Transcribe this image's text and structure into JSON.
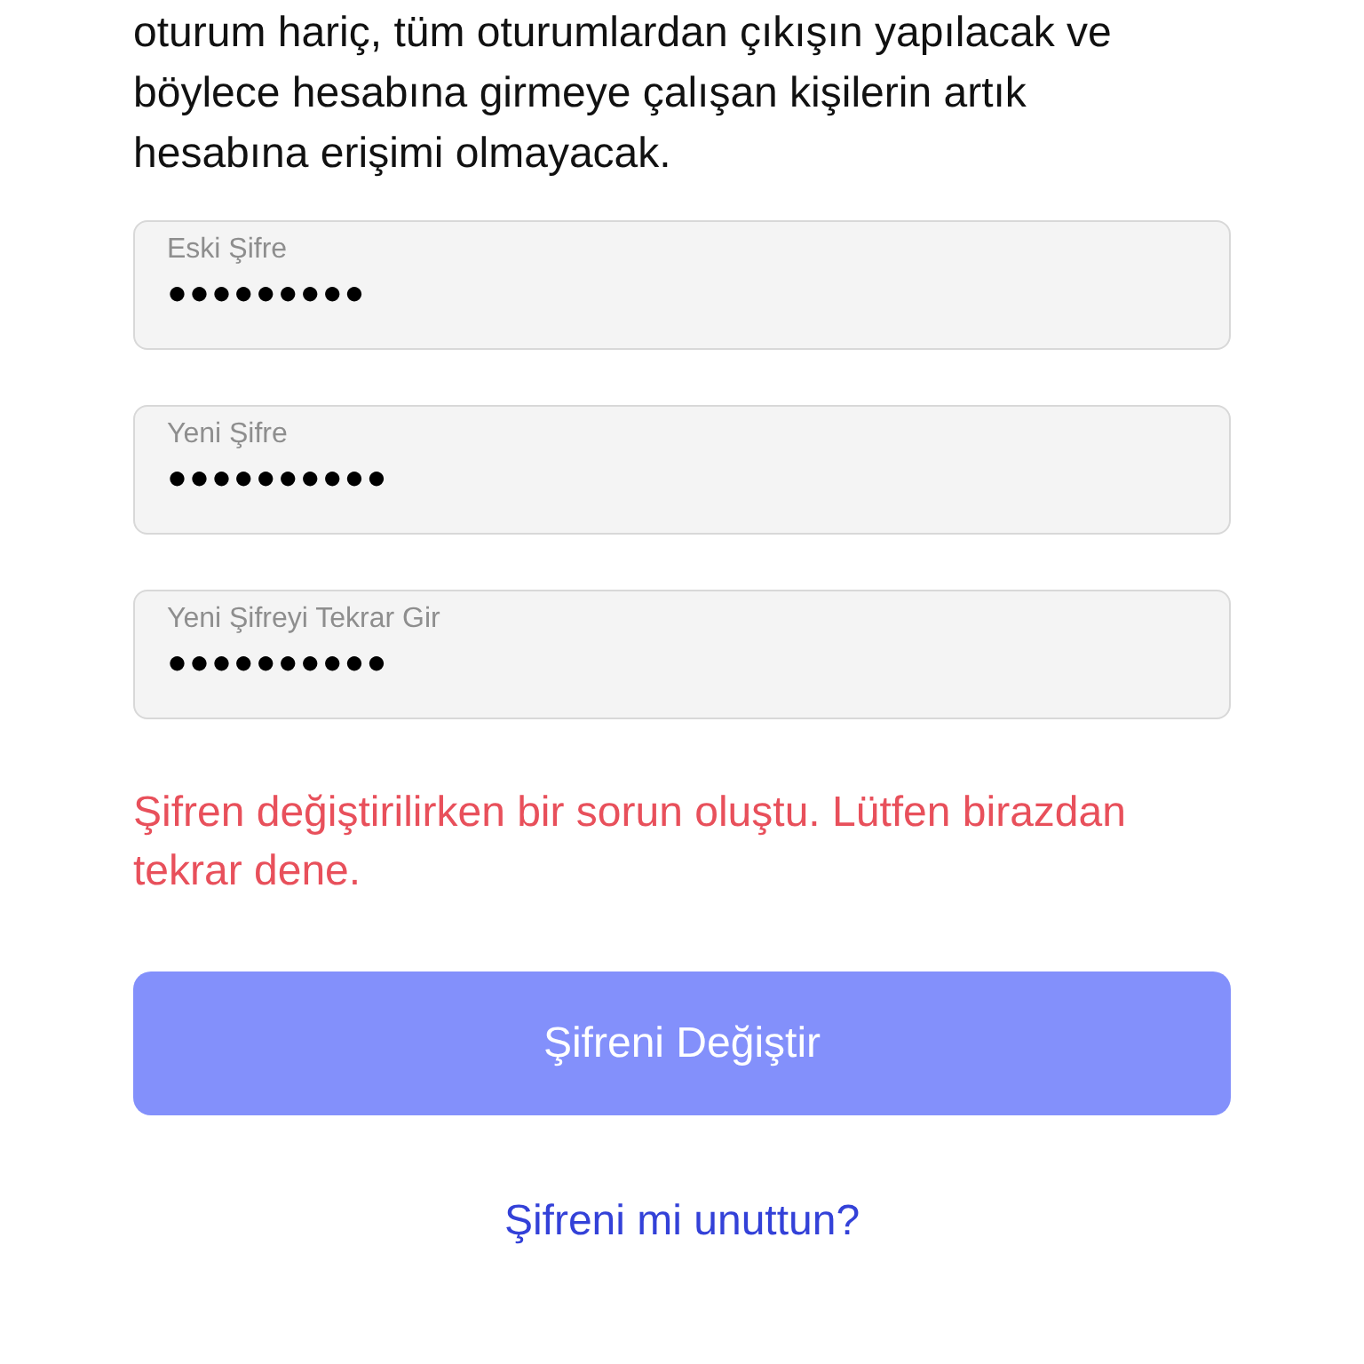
{
  "description": {
    "text": "oturum hariç, tüm oturumlardan çıkışın yapılacak ve böylece hesabına girmeye çalışan kişilerin artık hesabına erişimi olmayacak."
  },
  "fields": [
    {
      "label": "Eski Şifre",
      "value": "●●●●●●●●●"
    },
    {
      "label": "Yeni Şifre",
      "value": "●●●●●●●●●●"
    },
    {
      "label": "Yeni Şifreyi Tekrar Gir",
      "value": "●●●●●●●●●●"
    }
  ],
  "error": {
    "text": "Şifren değiştirilirken bir sorun oluştu. Lütfen birazdan tekrar dene."
  },
  "submit_button": {
    "label": "Şifreni Değiştir",
    "disabled": true
  },
  "forgot_link": {
    "label": "Şifreni mi unuttun?"
  }
}
